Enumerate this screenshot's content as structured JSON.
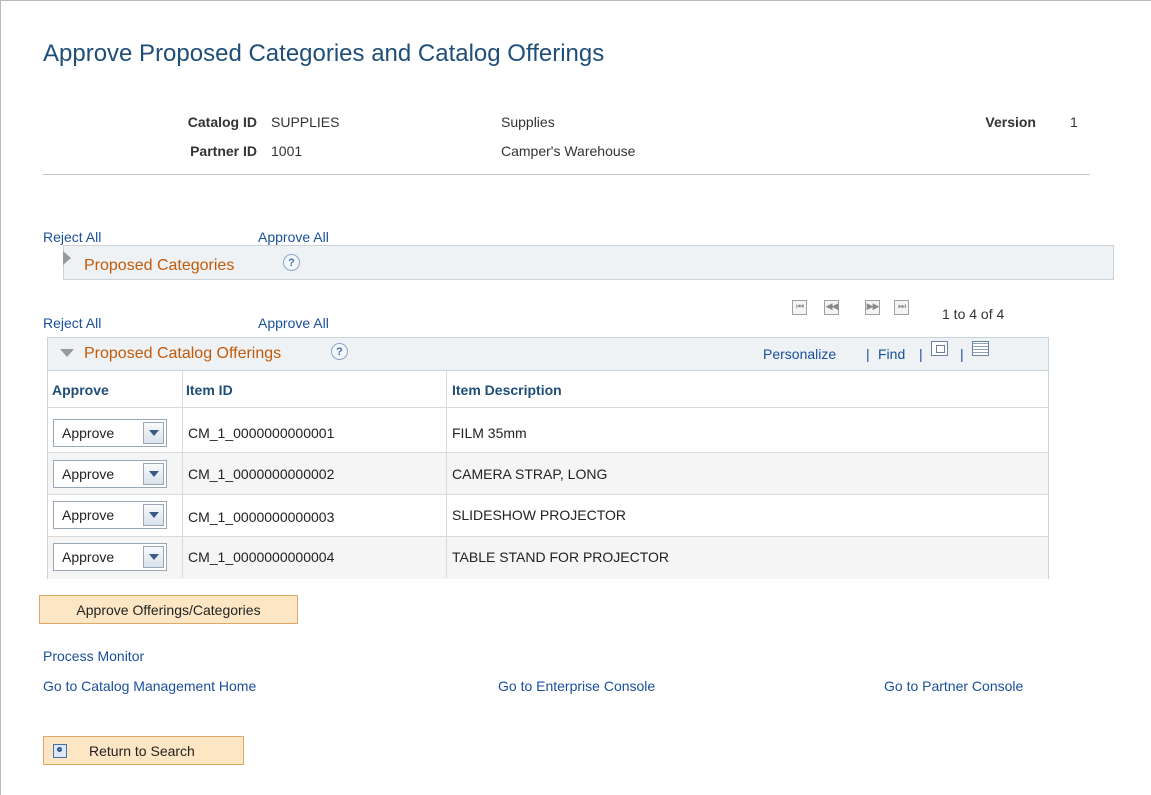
{
  "page": {
    "title": "Approve Proposed Categories and Catalog Offerings"
  },
  "header": {
    "catalog_id_label": "Catalog ID",
    "catalog_id_value": "SUPPLIES",
    "catalog_desc": "Supplies",
    "partner_id_label": "Partner ID",
    "partner_id_value": "1001",
    "partner_desc": "Camper's Warehouse",
    "version_label": "Version",
    "version_value": "1"
  },
  "categories": {
    "reject_all": "Reject All",
    "approve_all": "Approve All",
    "title": "Proposed Categories",
    "help": "?"
  },
  "offerings": {
    "reject_all": "Reject All",
    "approve_all": "Approve All",
    "title": "Proposed Catalog Offerings",
    "help": "?",
    "pager": {
      "first": "⏮",
      "prev": "◀◀",
      "next": "▶▶",
      "last": "⏭",
      "range": "1 to 4 of 4"
    },
    "tools": {
      "personalize": "Personalize",
      "separator": "|",
      "find": "Find"
    },
    "columns": [
      "Approve",
      "Item ID",
      "Item Description"
    ],
    "rows": [
      {
        "approve": "Approve",
        "item_id": "CM_1_0000000000001",
        "desc": "FILM 35mm"
      },
      {
        "approve": "Approve",
        "item_id": "CM_1_0000000000002",
        "desc": "CAMERA STRAP, LONG"
      },
      {
        "approve": "Approve",
        "item_id": "CM_1_0000000000003",
        "desc": "SLIDESHOW PROJECTOR"
      },
      {
        "approve": "Approve",
        "item_id": "CM_1_0000000000004",
        "desc": "TABLE STAND FOR PROJECTOR"
      }
    ]
  },
  "actions": {
    "approve_button": "Approve Offerings/Categories",
    "process_monitor": "Process Monitor",
    "catalog_home": "Go to Catalog Management Home",
    "enterprise_console": "Go to Enterprise Console",
    "partner_console": "Go to Partner Console",
    "return_to_search": "Return to Search"
  },
  "icons": {
    "expand": "triangle-right-icon",
    "collapse": "triangle-down-icon",
    "help": "help-icon",
    "zoom": "zoom-grid-icon",
    "download": "download-grid-icon",
    "return": "search-return-icon"
  },
  "colors": {
    "title": "#1f4e79",
    "link": "#1a4f9c",
    "section_title": "#c25a0a",
    "button_bg": "#fce6c4",
    "button_border": "#e0a96a"
  }
}
